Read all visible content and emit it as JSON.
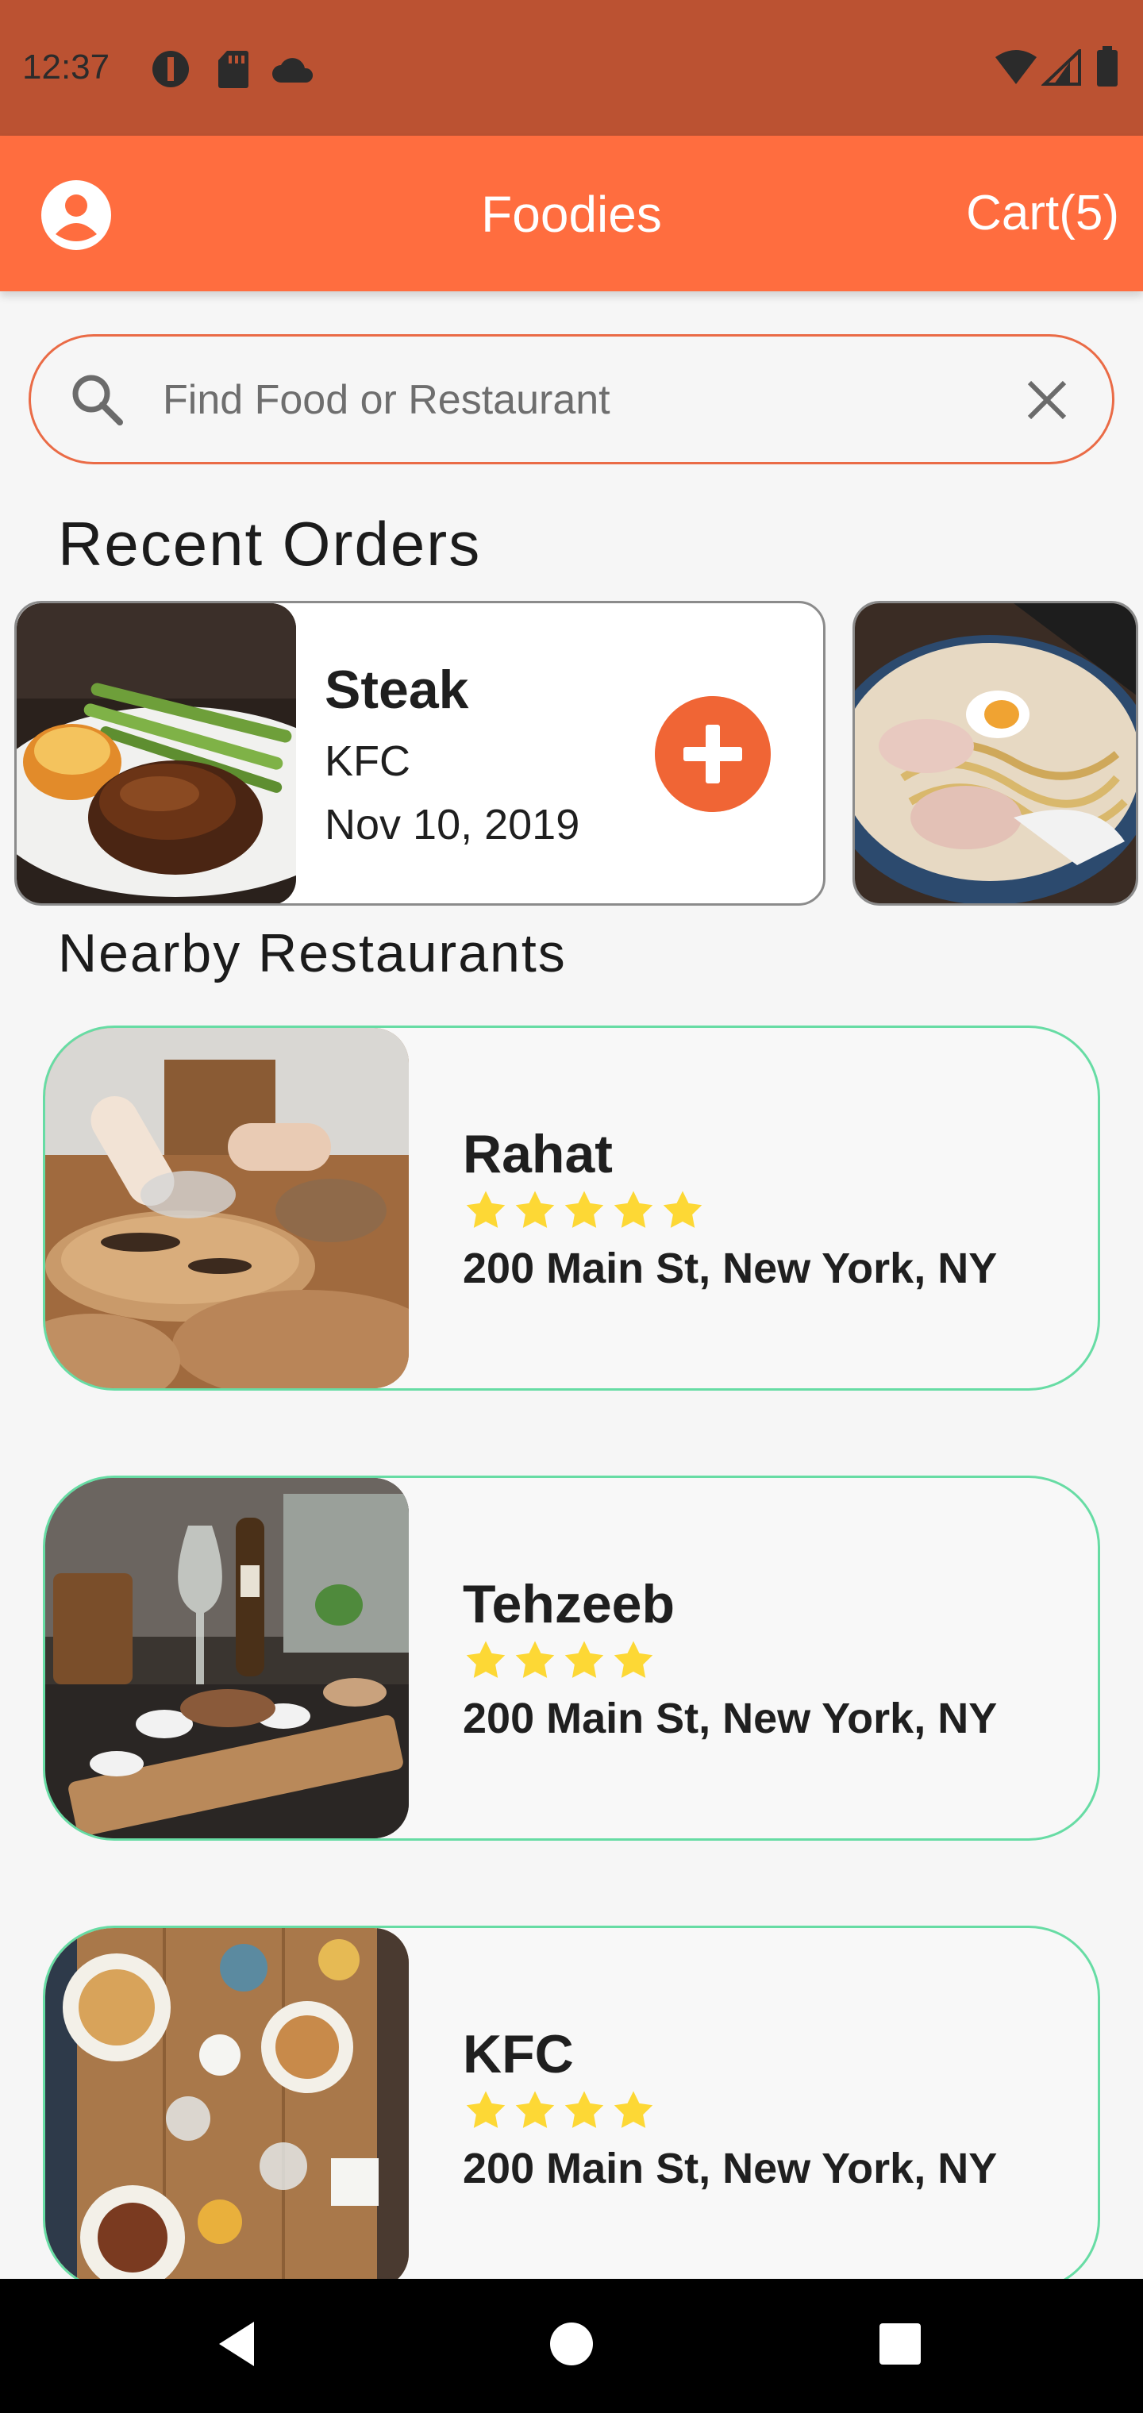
{
  "status_bar": {
    "time": "12:37",
    "icons": [
      "notification-icon",
      "sd-card-icon",
      "cloud-icon",
      "wifi-icon",
      "signal-icon",
      "battery-icon"
    ]
  },
  "app_bar": {
    "title": "Foodies",
    "cart_label": "Cart(5)",
    "account_icon": "account-circle-icon"
  },
  "search": {
    "placeholder": "Find Food or Restaurant",
    "value": ""
  },
  "recent_orders": {
    "title": "Recent Orders",
    "items": [
      {
        "name": "Steak",
        "restaurant": "KFC",
        "date": "Nov 10, 2019",
        "image": "steak-photo"
      },
      {
        "image": "ramen-photo"
      }
    ]
  },
  "nearby": {
    "title": "Nearby Restaurants",
    "items": [
      {
        "name": "Rahat",
        "rating": 5,
        "address": "200 Main St, New York, NY",
        "image": "chef-plating-photo"
      },
      {
        "name": "Tehzeeb",
        "rating": 4,
        "address": "200 Main St, New York, NY",
        "image": "restaurant-table-photo"
      },
      {
        "name": "KFC",
        "rating": 4,
        "address": "200 Main St, New York, NY",
        "image": "dining-table-overhead-photo"
      }
    ]
  },
  "colors": {
    "status_bar": "#bb5232",
    "app_bar": "#ff6d3f",
    "accent": "#f06535",
    "card_border": "#67dca4",
    "star": "#fdd835"
  },
  "nav_bar": {
    "icons": [
      "back-icon",
      "home-icon",
      "recents-icon"
    ]
  }
}
